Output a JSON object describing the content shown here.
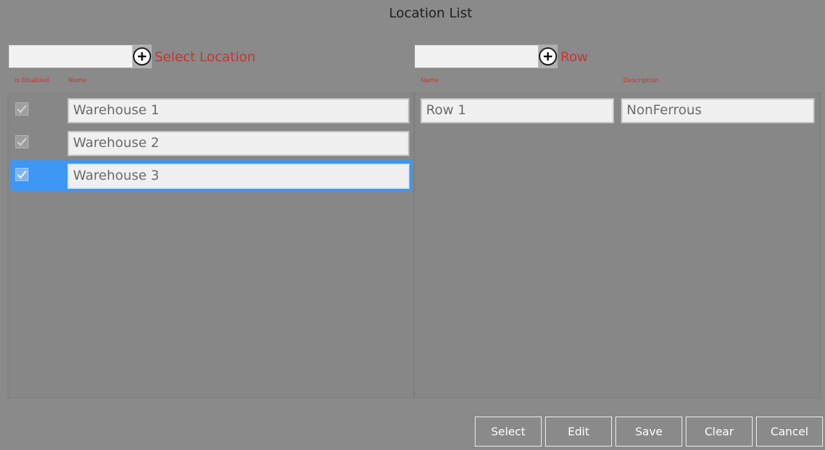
{
  "window": {
    "title": "Location List"
  },
  "left": {
    "search_value": "",
    "label": "Select Location",
    "headers": {
      "is_disabled": "Is Disabled",
      "name": "Name"
    },
    "rows": [
      {
        "name": "Warehouse 1",
        "is_disabled": true,
        "selected": false
      },
      {
        "name": "Warehouse 2",
        "is_disabled": true,
        "selected": false
      },
      {
        "name": "Warehouse 3",
        "is_disabled": true,
        "selected": true
      }
    ]
  },
  "right": {
    "search_value": "",
    "label": "Row",
    "headers": {
      "name": "Name",
      "description": "Description"
    },
    "rows": [
      {
        "name": "Row 1",
        "description": "NonFerrous"
      }
    ]
  },
  "buttons": {
    "select": "Select",
    "edit": "Edit",
    "save": "Save",
    "clear": "Clear",
    "cancel": "Cancel"
  },
  "colors": {
    "background": "#8a8a8a",
    "label_red": "#c8342f",
    "selection_blue": "#3c97f5"
  },
  "icons": {
    "add": "plus-circle-icon",
    "check": "checkmark-icon"
  }
}
